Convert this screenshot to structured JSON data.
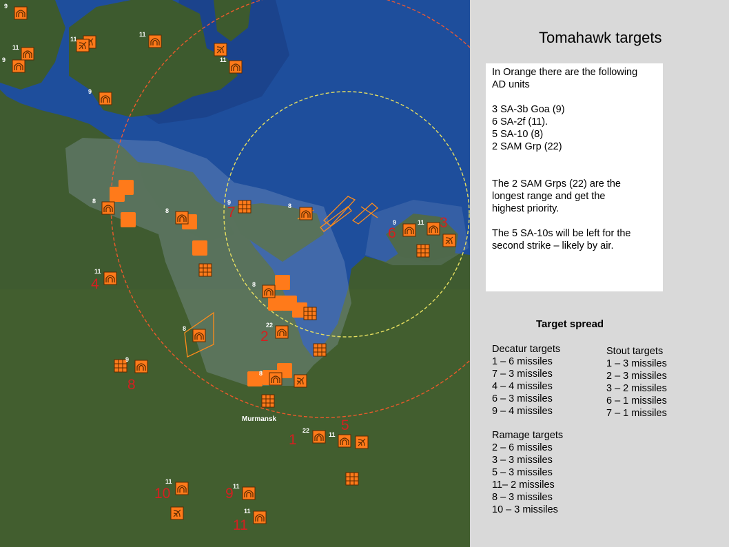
{
  "panel": {
    "title": "Tomahawk targets",
    "info_lines": [
      "In Orange there are the following",
      "AD units",
      "3 SA-3b Goa (9)",
      "6 SA-2f (11).",
      "5 SA-10 (8)",
      "2 SAM Grp (22)",
      "The 2 SAM Grps (22) are the",
      "longest range and get the",
      "highest priority.",
      "The 5 SA-10s will be left for the",
      "second strike – likely by air."
    ],
    "spread_title": "Target spread",
    "decatur": {
      "heading": "Decatur targets",
      "items": [
        "1 – 6 missiles",
        "7 – 3 missiles",
        "4 – 4 missiles",
        "6 – 3 missiles",
        "9 – 4 missiles"
      ]
    },
    "stout": {
      "heading": "Stout targets",
      "items": [
        "1 – 3 missiles",
        "2 – 3 missiles",
        "3 – 2 missiles",
        "6 – 1 missiles",
        "7 – 1 missiles"
      ]
    },
    "ramage": {
      "heading": "Ramage targets",
      "items": [
        "2 – 6 missiles",
        "3 – 3 missiles",
        "5 – 3 missiles",
        "11– 2 missiles",
        "8 – 3 missiles",
        "10 – 3 missiles"
      ]
    }
  },
  "map": {
    "city_label": "Murmansk",
    "colors": {
      "unit": "#ff7a1a",
      "target_label": "#d42020",
      "range_outer": "#ff5a2a",
      "range_inner": "#e8e060",
      "water": "#1f4f9a",
      "land": "#3d5a2e"
    },
    "target_numbers": [
      "1",
      "2",
      "3",
      "4",
      "5",
      "6",
      "7",
      "8",
      "9",
      "10",
      "11"
    ],
    "unit_codes": [
      "9",
      "11",
      "9",
      "11",
      "11",
      "9",
      "11",
      "8",
      "8",
      "9",
      "8",
      "9",
      "11",
      "11",
      "8",
      "22",
      "8",
      "9",
      "8",
      "22",
      "11",
      "11",
      "11",
      "11"
    ]
  }
}
